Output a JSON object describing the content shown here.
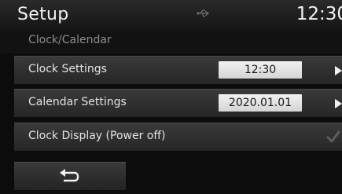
{
  "header": {
    "title": "Setup",
    "time": "12:30",
    "status_icon": "usb-icon"
  },
  "breadcrumb": "Clock/Calendar",
  "settings": [
    {
      "label": "Clock Settings",
      "value": "12:30",
      "control": "arrow-right-icon"
    },
    {
      "label": "Calendar Settings",
      "value": "2020.01.01",
      "control": "arrow-right-icon"
    },
    {
      "label": "Clock Display (Power off)",
      "checked": true,
      "control": "checkmark-icon"
    }
  ],
  "footer": {
    "back_icon": "back-arrow-icon"
  },
  "colors": {
    "background": "#0c0c0c",
    "row": "#2f2f2f",
    "value_box": "#e6e6e6"
  }
}
